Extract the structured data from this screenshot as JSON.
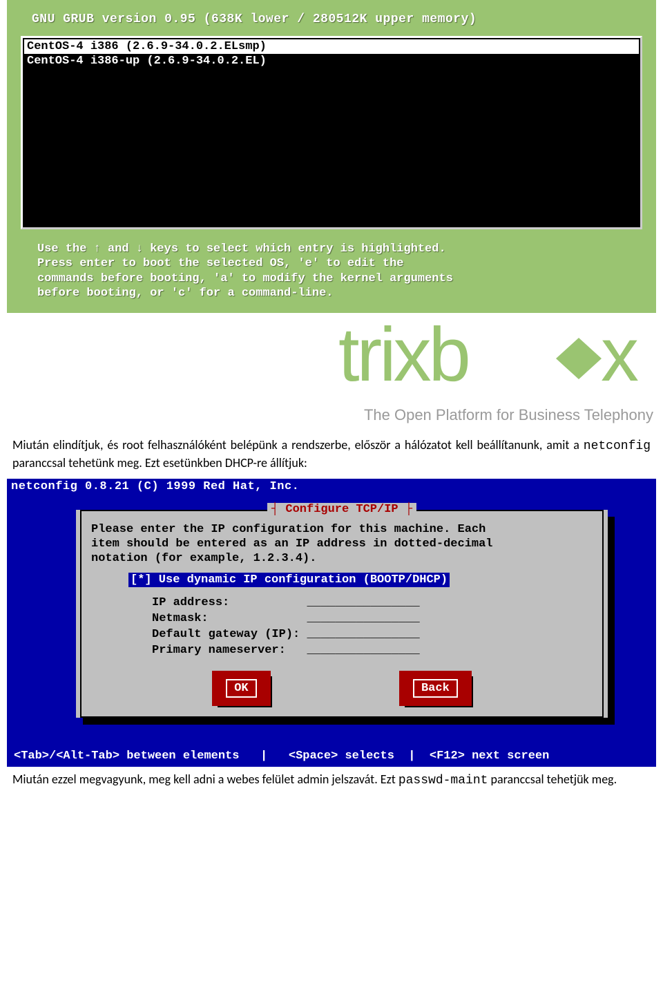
{
  "grub": {
    "title": "GNU GRUB  version 0.95  (638K lower / 280512K upper memory)",
    "entries": [
      {
        "label": "CentOS-4 i386 (2.6.9-34.0.2.ELsmp)",
        "selected": true
      },
      {
        "label": "CentOS-4 i386-up (2.6.9-34.0.2.EL)",
        "selected": false
      }
    ],
    "help": "Use the ↑ and ↓ keys to select which entry is highlighted.\nPress enter to boot the selected OS, 'e' to edit the\ncommands before booting, 'a' to modify the kernel arguments\nbefore booting, or 'c' for a command-line."
  },
  "trixbox": {
    "brand": "trixbox",
    "tagline": "The Open Platform for Business Telephony"
  },
  "doc": {
    "p1a": "Miután elindítjuk, és root felhasználóként belépünk a rendszerbe, először a hálózatot kell beállítanunk, amit a ",
    "p1_cmd": "netconfig",
    "p1b": " paranccsal tehetünk meg. Ezt esetünkben DHCP-re állítjuk:",
    "p2a": "Miután ezzel megvagyunk, meg kell adni a webes felület admin jelszavát. Ezt ",
    "p2_cmd": "passwd-maint",
    "p2b": " paranccsal tehetjük meg."
  },
  "netconfig": {
    "top": "netconfig 0.8.21  (C) 1999 Red Hat, Inc.",
    "title": "Configure TCP/IP",
    "instructions": "Please enter the IP configuration for this machine. Each\nitem should be entered as an IP address in dotted-decimal\nnotation (for example, 1.2.3.4).",
    "dhcp": "[*] Use dynamic IP configuration (BOOTP/DHCP)",
    "fields": [
      {
        "label": "IP address:",
        "value": "________________"
      },
      {
        "label": "Netmask:",
        "value": "________________"
      },
      {
        "label": "Default gateway (IP):",
        "value": "________________"
      },
      {
        "label": "Primary nameserver:",
        "value": "________________"
      }
    ],
    "ok": "OK",
    "back": "Back",
    "bottom": "<Tab>/<Alt-Tab> between elements   |   <Space> selects  |  <F12> next screen"
  }
}
